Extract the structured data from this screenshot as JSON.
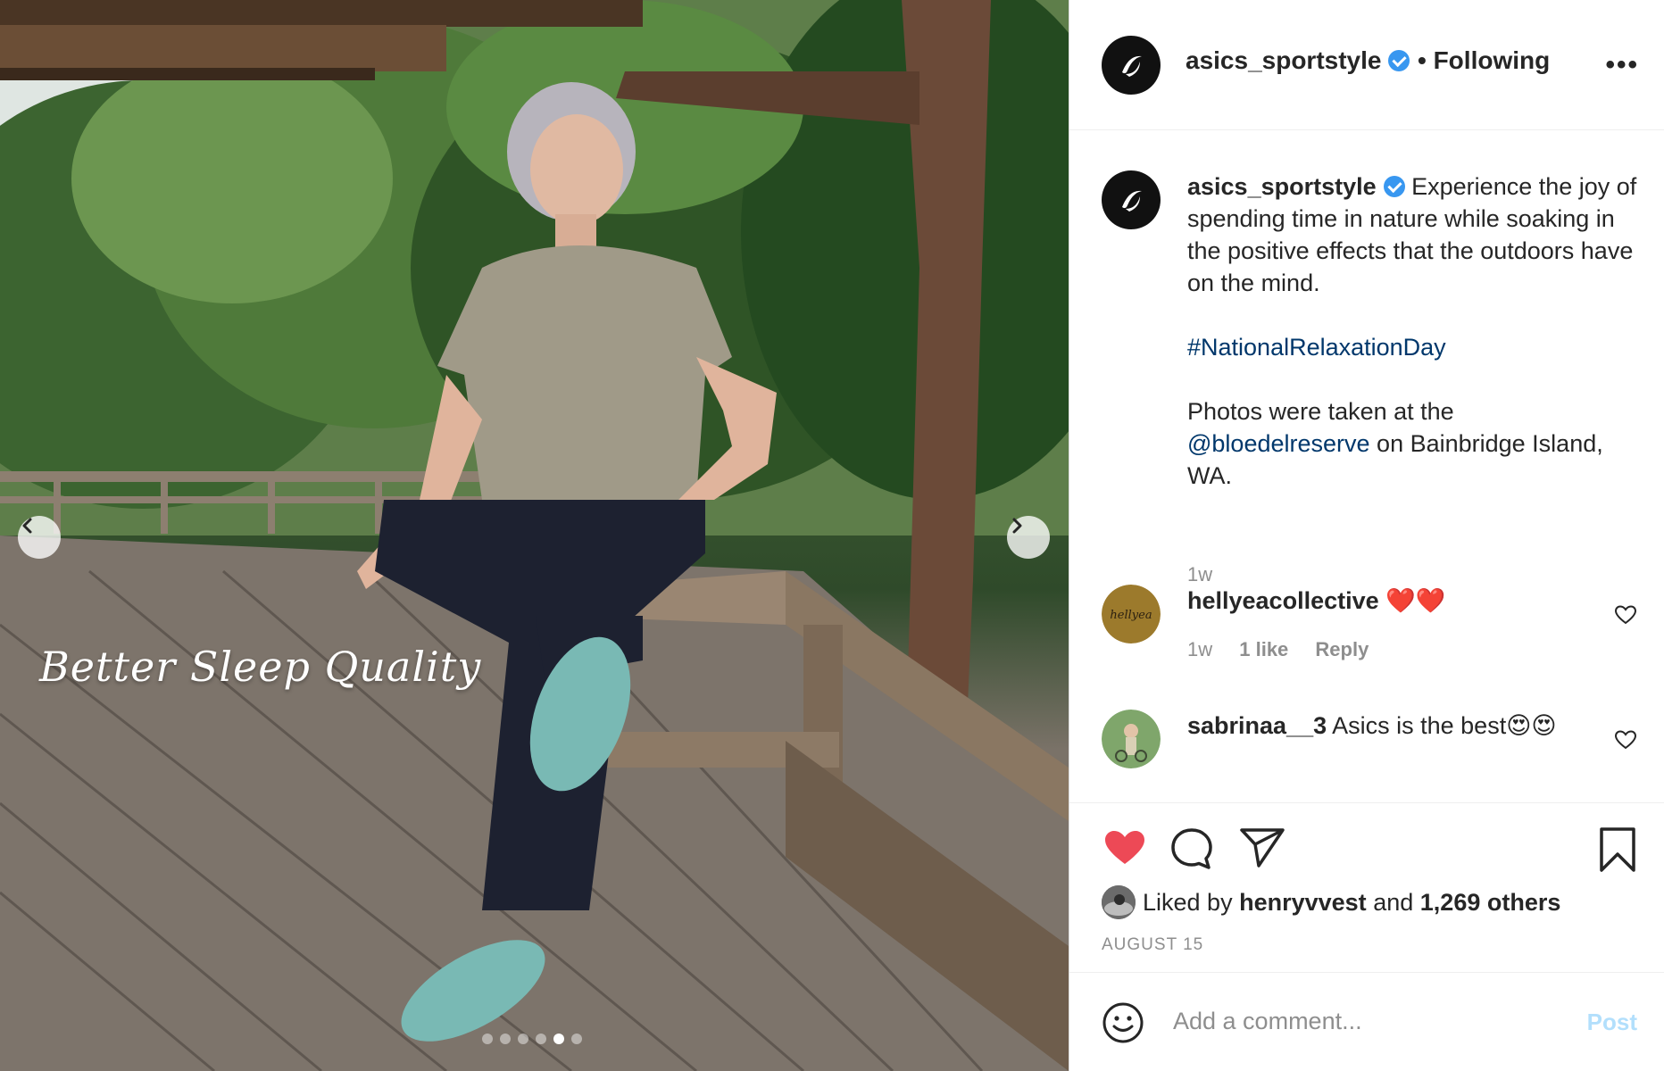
{
  "photo": {
    "overlay_text": "Better Sleep Quality",
    "slides_total": 6,
    "slide_active": 5,
    "prev_icon": "chevron-left-icon",
    "next_icon": "chevron-right-icon"
  },
  "header": {
    "username": "asics_sportstyle",
    "following_label": "• Following",
    "more_icon": "more-options-icon",
    "more_label": "•••"
  },
  "caption": {
    "username": "asics_sportstyle",
    "text_1": "Experience the joy of spending time in nature while soaking in the positive effects that the outdoors have on the mind.",
    "hashtag": "#NationalRelaxationDay",
    "text_2": "Photos were taken at the",
    "mention": "@bloedelreserve",
    "text_3": "on Bainbridge Island, WA.",
    "time": "1w"
  },
  "comments": [
    {
      "username": "hellyeacollective",
      "text": "❤️❤️",
      "time": "1w",
      "likes": "1 like",
      "reply": "Reply"
    },
    {
      "username": "sabrinaa__3",
      "text": "Asics is the best😍😍"
    }
  ],
  "actions": {
    "liked": true,
    "liked_by_prefix": "Liked by",
    "liked_by_user": "henryvvest",
    "liked_by_and": "and",
    "liked_by_others": "1,269 others",
    "date": "AUGUST 15"
  },
  "add_comment": {
    "placeholder": "Add a comment...",
    "post_label": "Post"
  },
  "colors": {
    "like_red": "#ed4956",
    "link_blue": "#00376b",
    "verified_blue": "#3897f0",
    "muted": "#8e8e8e",
    "post_disabled": "#b2dffc"
  }
}
